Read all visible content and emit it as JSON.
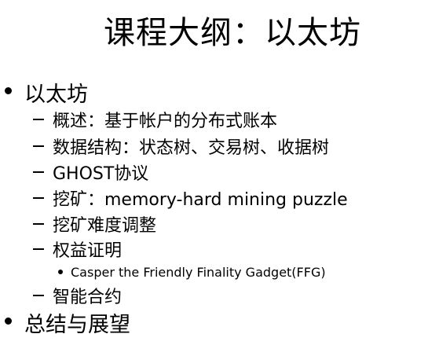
{
  "title": "课程大纲：以太坊",
  "outline": {
    "items": [
      {
        "level": 1,
        "text": "以太坊"
      },
      {
        "level": 2,
        "text": "概述：基于帐户的分布式账本"
      },
      {
        "level": 2,
        "text": "数据结构：状态树、交易树、收据树"
      },
      {
        "level": 2,
        "text": "GHOST协议"
      },
      {
        "level": 2,
        "text": "挖矿：memory-hard mining puzzle"
      },
      {
        "level": 2,
        "text": "挖矿难度调整"
      },
      {
        "level": 2,
        "text": "权益证明"
      },
      {
        "level": 3,
        "text": "Casper the Friendly Finality Gadget(FFG)"
      },
      {
        "level": 2,
        "text": "智能合约"
      },
      {
        "level": 1,
        "text": "总结与展望"
      }
    ]
  }
}
